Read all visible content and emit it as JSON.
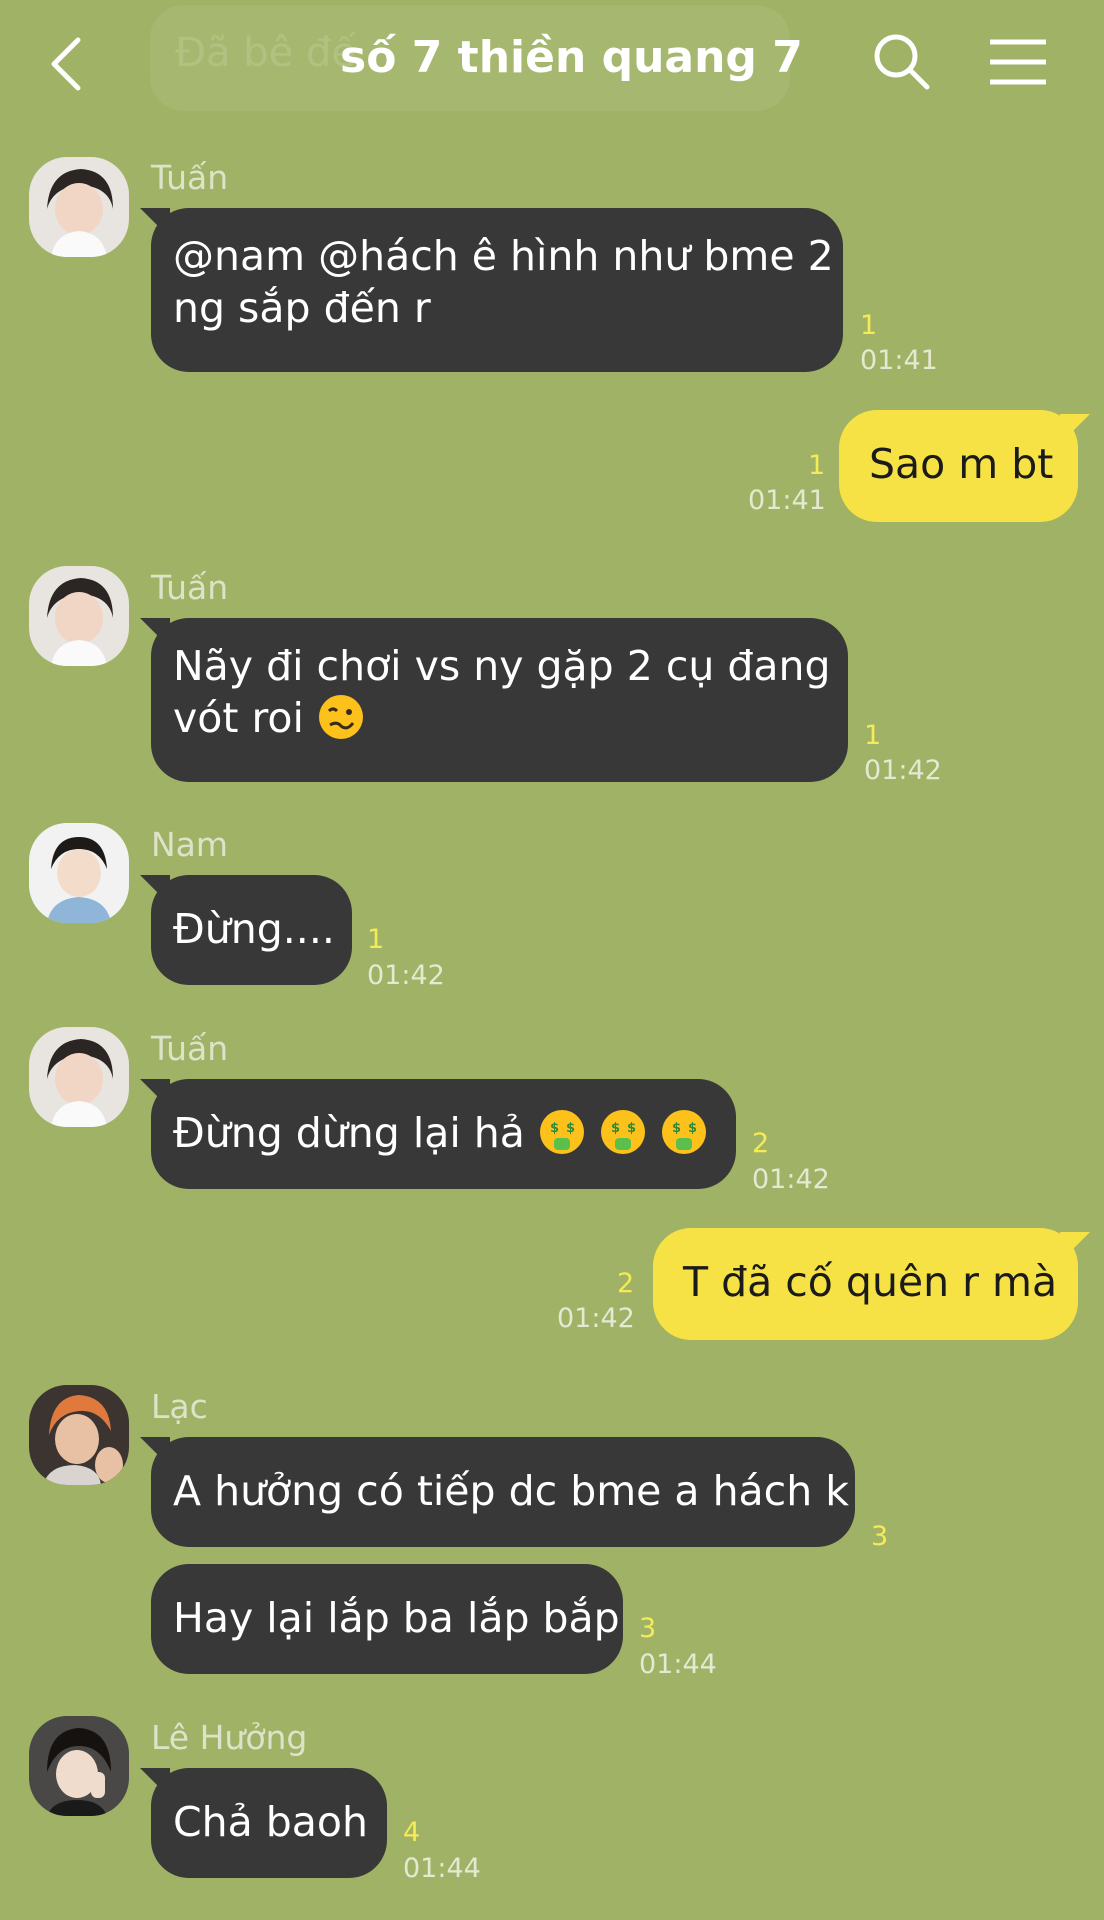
{
  "header": {
    "title": "số 7 thiền quang 7",
    "ghost_text": "Đã bê đế",
    "back_icon": "chevron-left-icon",
    "search_icon": "search-icon",
    "menu_icon": "hamburger-menu-icon"
  },
  "colors": {
    "background": "#9fb265",
    "incoming_bubble": "#383838",
    "outgoing_bubble": "#f7e245",
    "read_count": "#f6ea57"
  },
  "messages": [
    {
      "sender": "Tuấn",
      "lines": [
        "@nam @hách ê hình như bme 2",
        "ng sắp đến r"
      ],
      "count": "1",
      "time": "01:41"
    },
    {
      "mine": true,
      "text": "Sao m bt",
      "count": "1",
      "time": "01:41"
    },
    {
      "sender": "Tuấn",
      "lines": [
        "Nãy đi chơi vs ny gặp 2 cụ đang",
        "vót roi"
      ],
      "emoji": "woozy-face-icon",
      "count": "1",
      "time": "01:42"
    },
    {
      "sender": "Nam",
      "text": "Đừng....",
      "count": "1",
      "time": "01:42"
    },
    {
      "sender": "Tuấn",
      "text": "Đừng dừng lại hả",
      "emoji": "money-mouth-face-icon",
      "count": "2",
      "time": "01:42"
    },
    {
      "mine": true,
      "text": "T đã cố quên r mà",
      "count": "2",
      "time": "01:42"
    },
    {
      "sender": "Lạc",
      "text": "A hưởng có tiếp dc bme a hách k",
      "count": "3"
    },
    {
      "text": "Hay lại lắp ba lắp bắp",
      "count": "3",
      "time": "01:44"
    },
    {
      "sender": "Lê Hưởng",
      "text": "Chả baoh",
      "count": "4",
      "time": "01:44"
    }
  ]
}
